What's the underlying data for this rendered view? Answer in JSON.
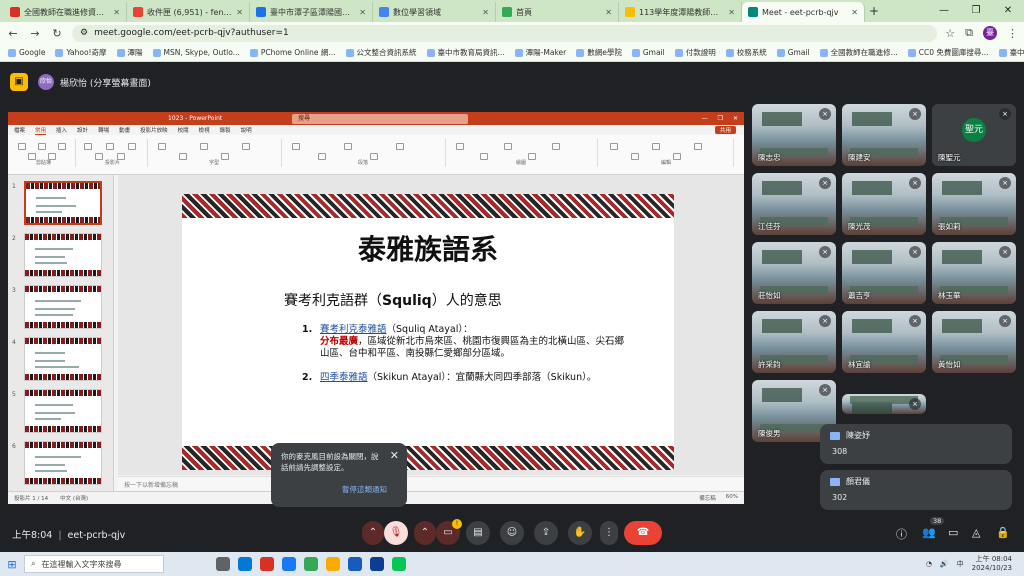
{
  "browser": {
    "tabs": [
      {
        "title": "全國教師在職進修資訊網",
        "color": "#d93025"
      },
      {
        "title": "收件匣 (6,951) - fenn0427@g",
        "color": "#ea4335"
      },
      {
        "title": "臺中市潭子區潭陽國民小學",
        "color": "#1a73e8"
      },
      {
        "title": "數位學習領域",
        "color": "#4285f4"
      },
      {
        "title": "首頁",
        "color": "#34a853"
      },
      {
        "title": "113學年度潭陽教師聯絡教室",
        "color": "#fbbc04"
      },
      {
        "title": "Meet - eet-pcrb-qjv",
        "color": "#00897b"
      }
    ],
    "new_tab": "+",
    "url": "meet.google.com/eet-pcrb-qjv?authuser=1",
    "profile_initial": "臺",
    "bookmarks": [
      "Google",
      "Yahoo!奇摩",
      "潭陽",
      "MSN, Skype, Outlo...",
      "PChome Online 網...",
      "公文整合資訊系統",
      "臺中市教育局資訊...",
      "潭陽-Maker",
      "數網e學院",
      "Gmail",
      "付款證明",
      "校務系統",
      "Gmail",
      "全國教師在職進修...",
      "CC0 免費圖庫搜尋...",
      "臺中市雲端數位學..."
    ]
  },
  "meet": {
    "presenter_label": "楊欣怡 (分享螢幕畫面)",
    "presenter_avatar": "欣怡",
    "meeting_code": "eet-pcrb-qjv",
    "time": "上午8:04",
    "participants_count": "38"
  },
  "powerpoint": {
    "window_title": "1023 - PowerPoint",
    "search_placeholder": "搜尋",
    "menu": [
      "檔案",
      "常用",
      "插入",
      "設計",
      "轉場",
      "動畫",
      "投影片放映",
      "校閱",
      "檢視",
      "錄製",
      "說明"
    ],
    "share": "共用",
    "ribbon_groups": [
      "剪貼簿",
      "投影片",
      "字型",
      "段落",
      "繪圖",
      "編輯"
    ],
    "slide_numbers": [
      "1",
      "2",
      "3",
      "4",
      "5",
      "6"
    ],
    "notes_placeholder": "按一下以新增備忘稿",
    "status_left": "投影片 1 / 14",
    "status_lang": "中文 (台灣)",
    "status_notes": "備忘稿",
    "zoom": "60%"
  },
  "slide": {
    "title": "泰雅族語系",
    "subtitle_prefix": "賽考利克語群（",
    "subtitle_term": "Squliq",
    "subtitle_suffix": "）人的意思",
    "items": [
      {
        "num": "1.",
        "name": "賽考利克泰雅語",
        "alt": "（Squliq Atayal）：",
        "highlight": "分布最廣",
        "desc": "，區域從新北市烏來區、桃園市復興區為主的北橫山區、尖石鄉山區、台中和平區、南投縣仁愛鄉部分區域。"
      },
      {
        "num": "2.",
        "name": "四季泰雅語",
        "alt": "（Skikun Atayal）：",
        "highlight": "",
        "desc": "宜蘭縣大同四季部落（Skikun）。"
      }
    ]
  },
  "tiles": [
    {
      "name": "陳志忠"
    },
    {
      "name": "陳建安"
    },
    {
      "name": "陳聖元",
      "avatar": "聖元"
    },
    {
      "name": "江佳芬"
    },
    {
      "name": "陳光茂"
    },
    {
      "name": "張如莉"
    },
    {
      "name": "莊怡如"
    },
    {
      "name": "蕭吉亨"
    },
    {
      "name": "林玉華"
    },
    {
      "name": "許采鈞"
    },
    {
      "name": "林宜諭"
    },
    {
      "name": "黃怡如"
    },
    {
      "name": "陳俊男"
    },
    {
      "name": ""
    }
  ],
  "chats": [
    {
      "sender": "陳姿妤",
      "message": "308"
    },
    {
      "sender": "顏君儀",
      "message": "302"
    }
  ],
  "toast": {
    "text": "你的麥克風目前設為關閉，說話前請先調整設定。",
    "action": "暫停這類通知"
  },
  "taskbar": {
    "search_placeholder": "在這裡輸入文字來搜尋",
    "time": "上午 08:04",
    "date": "2024/10/23",
    "lang": "中"
  }
}
